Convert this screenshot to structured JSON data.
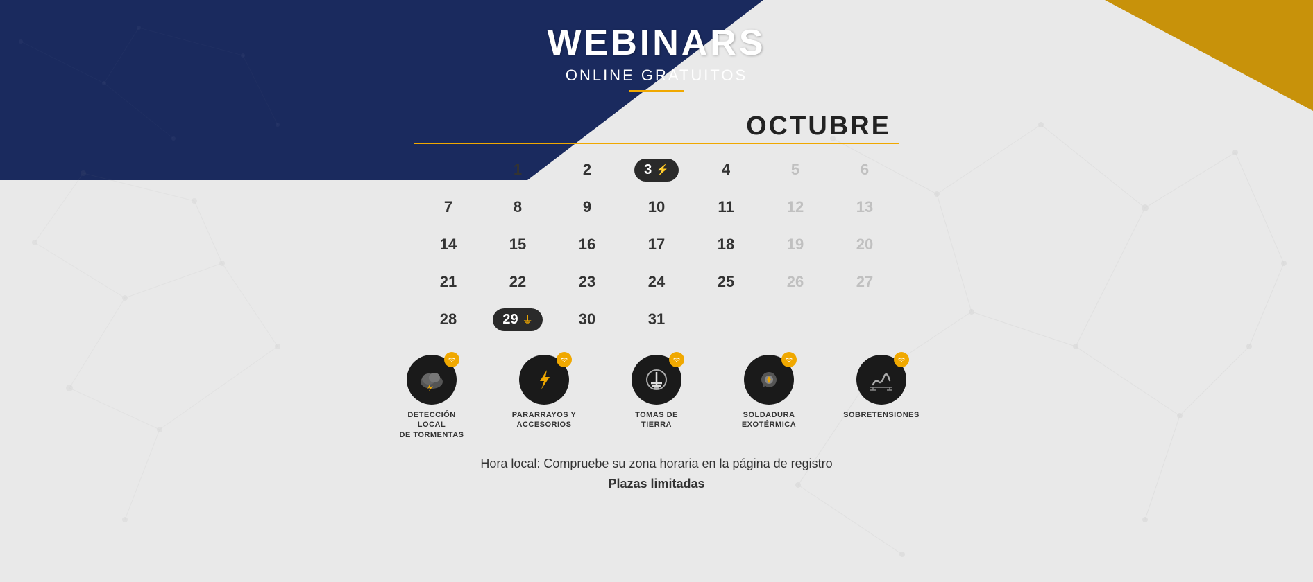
{
  "header": {
    "title": "WEBINARS",
    "subtitle": "ONLINE GRATUITOS"
  },
  "month": {
    "name": "OCTUBRE"
  },
  "calendar": {
    "weeks": [
      {
        "days": [
          {
            "num": "",
            "empty": true
          },
          {
            "num": "1",
            "empty": false
          },
          {
            "num": "2",
            "empty": false
          },
          {
            "num": "3",
            "highlight": true,
            "icon": "lightning"
          },
          {
            "num": "4",
            "empty": false
          },
          {
            "num": "5",
            "grayed": true
          },
          {
            "num": "6",
            "grayed": true
          }
        ]
      },
      {
        "days": [
          {
            "num": "7",
            "empty": false
          },
          {
            "num": "8",
            "empty": false
          },
          {
            "num": "9",
            "empty": false
          },
          {
            "num": "10",
            "empty": false
          },
          {
            "num": "11",
            "empty": false
          },
          {
            "num": "12",
            "grayed": true
          },
          {
            "num": "13",
            "grayed": true
          }
        ]
      },
      {
        "days": [
          {
            "num": "14",
            "empty": false
          },
          {
            "num": "15",
            "empty": false
          },
          {
            "num": "16",
            "empty": false
          },
          {
            "num": "17",
            "empty": false
          },
          {
            "num": "18",
            "empty": false
          },
          {
            "num": "19",
            "grayed": true
          },
          {
            "num": "20",
            "grayed": true
          }
        ]
      },
      {
        "days": [
          {
            "num": "21",
            "empty": false
          },
          {
            "num": "22",
            "empty": false
          },
          {
            "num": "23",
            "empty": false
          },
          {
            "num": "24",
            "empty": false
          },
          {
            "num": "25",
            "empty": false
          },
          {
            "num": "26",
            "grayed": true
          },
          {
            "num": "27",
            "grayed": true
          }
        ]
      },
      {
        "days": [
          {
            "num": "28",
            "empty": false
          },
          {
            "num": "29",
            "highlight": true,
            "icon": "ground"
          },
          {
            "num": "30",
            "empty": false
          },
          {
            "num": "31",
            "empty": false
          },
          {
            "num": "",
            "empty": true
          },
          {
            "num": "",
            "grayed": true,
            "empty2": true
          },
          {
            "num": "",
            "grayed": true,
            "empty2": true
          }
        ]
      }
    ]
  },
  "icons": [
    {
      "id": "deteccion",
      "label": "DETECCIÓN LOCAL\nDE TORMENTAS",
      "symbol": "☁",
      "wifi": true
    },
    {
      "id": "pararrayos",
      "label": "PARARRAYOS Y\nACCESORIOS",
      "symbol": "⚡",
      "wifi": true
    },
    {
      "id": "tomas",
      "label": "TOMAS DE\nTIERRA",
      "symbol": "⏚",
      "wifi": true
    },
    {
      "id": "soldadura",
      "label": "SOLDADURA\nEXOTÉRMICA",
      "symbol": "🔧",
      "wifi": true
    },
    {
      "id": "sobretensiones",
      "label": "SOBRETENSIONES",
      "symbol": "〜",
      "wifi": true
    }
  ],
  "footer": {
    "line1": "Hora local: Compruebe su zona horaria en la página de registro",
    "line2": "Plazas limitadas"
  },
  "colors": {
    "navy": "#1a2a5e",
    "gold": "#f0a800",
    "dark": "#2a2a2a",
    "gray": "#c0c0c0",
    "text": "#333333"
  }
}
